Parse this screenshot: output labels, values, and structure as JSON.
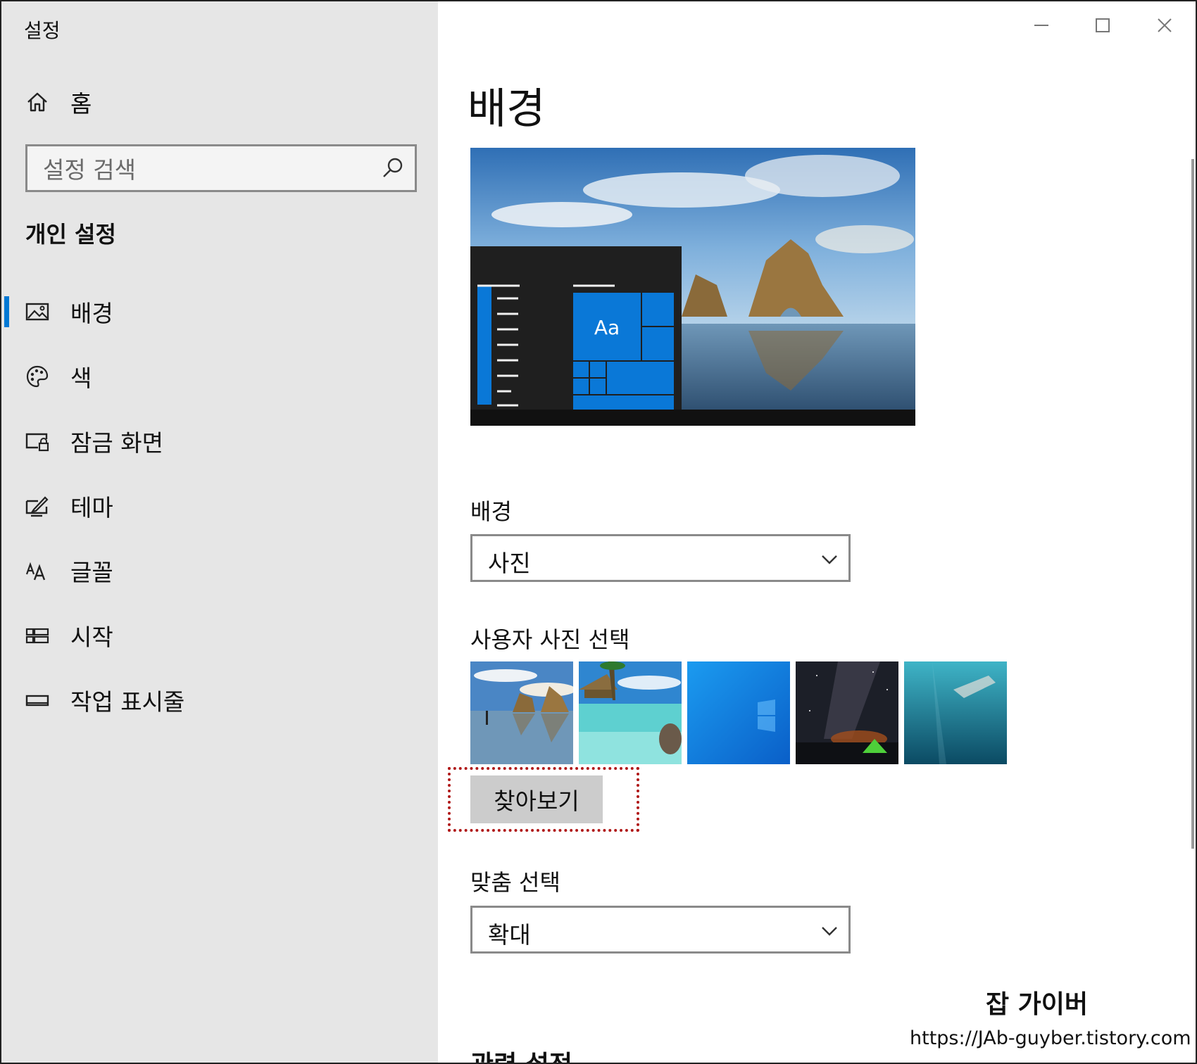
{
  "window": {
    "title": "설정",
    "controls": [
      "minimize-icon",
      "maximize-icon",
      "close-icon"
    ]
  },
  "sidebar": {
    "home_label": "홈",
    "search_placeholder": "설정 검색",
    "section_title": "개인 설정",
    "items": [
      {
        "label": "배경",
        "icon": "picture-icon",
        "active": true
      },
      {
        "label": "색",
        "icon": "palette-icon",
        "active": false
      },
      {
        "label": "잠금 화면",
        "icon": "lock-screen-icon",
        "active": false
      },
      {
        "label": "테마",
        "icon": "theme-icon",
        "active": false
      },
      {
        "label": "글꼴",
        "icon": "font-icon",
        "active": false
      },
      {
        "label": "시작",
        "icon": "start-icon",
        "active": false
      },
      {
        "label": "작업 표시줄",
        "icon": "taskbar-icon",
        "active": false
      }
    ]
  },
  "main": {
    "page_title": "배경",
    "preview": {
      "tile_text": "Aa"
    },
    "background_label": "배경",
    "background_value": "사진",
    "choose_label": "사용자 사진 선택",
    "thumbs": [
      "thumb-rock-beach",
      "thumb-tropical-beach",
      "thumb-windows-blue",
      "thumb-night-sky",
      "thumb-underwater"
    ],
    "browse_label": "찾아보기",
    "fit_label": "맞춤 선택",
    "fit_value": "확대",
    "related_title": "관련 설정"
  },
  "watermark": {
    "title": "잡 가이버",
    "url": "https://JAb-guyber.tistory.com"
  },
  "colors": {
    "accent": "#0078d4",
    "sidebar_bg": "#e6e6e6",
    "highlight": "#b01818"
  }
}
